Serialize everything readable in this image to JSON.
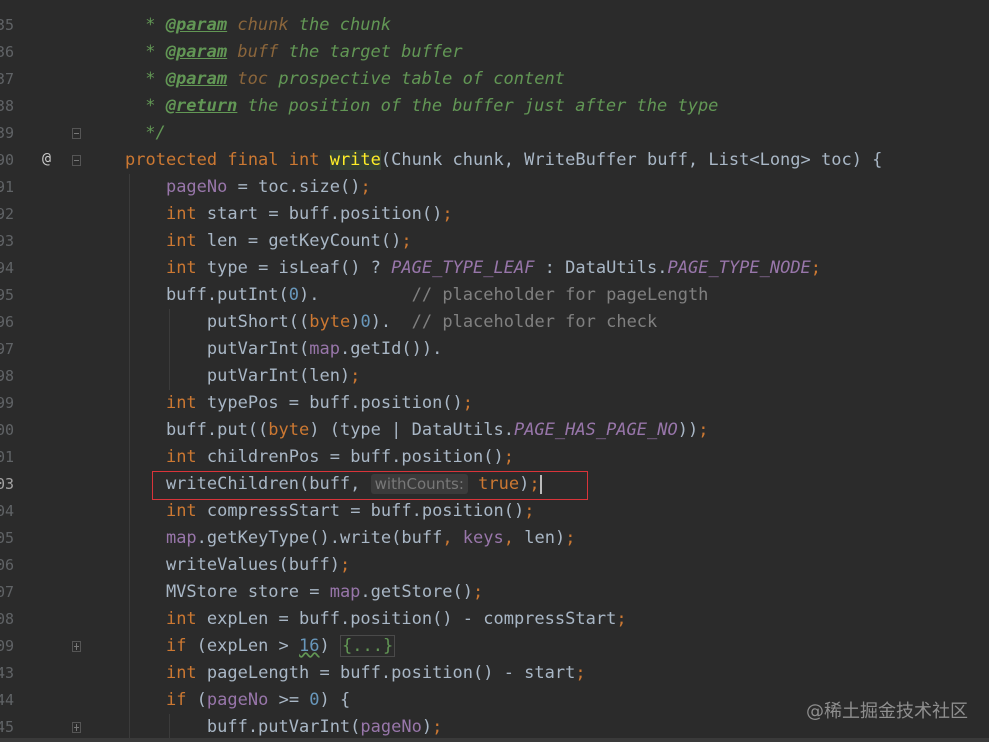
{
  "lines": [
    {
      "num": "35",
      "spans": [
        {
          "t": " * ",
          "c": "doc"
        },
        {
          "t": "@param",
          "c": "tag"
        },
        {
          "t": " ",
          "c": "doc"
        },
        {
          "t": "chunk",
          "c": "param"
        },
        {
          "t": " the chunk",
          "c": "doc"
        }
      ]
    },
    {
      "num": "36",
      "spans": [
        {
          "t": " * ",
          "c": "doc"
        },
        {
          "t": "@param",
          "c": "tag"
        },
        {
          "t": " ",
          "c": "doc"
        },
        {
          "t": "buff",
          "c": "param"
        },
        {
          "t": " the target buffer",
          "c": "doc"
        }
      ]
    },
    {
      "num": "37",
      "spans": [
        {
          "t": " * ",
          "c": "doc"
        },
        {
          "t": "@param",
          "c": "tag"
        },
        {
          "t": " ",
          "c": "doc"
        },
        {
          "t": "toc",
          "c": "param"
        },
        {
          "t": " prospective table of content",
          "c": "doc"
        }
      ]
    },
    {
      "num": "38",
      "spans": [
        {
          "t": " * ",
          "c": "doc"
        },
        {
          "t": "@return",
          "c": "tag"
        },
        {
          "t": " the position of the buffer just after the type",
          "c": "doc"
        }
      ]
    },
    {
      "num": "39",
      "spans": [
        {
          "t": " */",
          "c": "doc"
        }
      ]
    },
    {
      "num": "90",
      "spans": [
        {
          "t": "protected final int ",
          "c": "kw"
        },
        {
          "t": "write",
          "c": "hl"
        },
        {
          "t": "(Chunk chunk, WriteBuffer buff, List<Long> toc) {",
          "c": ""
        }
      ]
    },
    {
      "num": "91",
      "spans": [
        {
          "t": "    ",
          "c": ""
        },
        {
          "t": "pageNo",
          "c": "field"
        },
        {
          "t": " = toc.size()",
          "c": ""
        },
        {
          "t": ";",
          "c": "kw"
        }
      ]
    },
    {
      "num": "92",
      "spans": [
        {
          "t": "    ",
          "c": ""
        },
        {
          "t": "int ",
          "c": "kw"
        },
        {
          "t": "start = buff.position()",
          "c": ""
        },
        {
          "t": ";",
          "c": "kw"
        }
      ]
    },
    {
      "num": "93",
      "spans": [
        {
          "t": "    ",
          "c": ""
        },
        {
          "t": "int ",
          "c": "kw"
        },
        {
          "t": "len = getKeyCount()",
          "c": ""
        },
        {
          "t": ";",
          "c": "kw"
        }
      ]
    },
    {
      "num": "94",
      "spans": [
        {
          "t": "    ",
          "c": ""
        },
        {
          "t": "int ",
          "c": "kw"
        },
        {
          "t": "type = isLeaf() ? ",
          "c": ""
        },
        {
          "t": "PAGE_TYPE_LEAF",
          "c": "const"
        },
        {
          "t": " : DataUtils.",
          "c": ""
        },
        {
          "t": "PAGE_TYPE_NODE",
          "c": "const"
        },
        {
          "t": ";",
          "c": "kw"
        }
      ]
    },
    {
      "num": "95",
      "spans": [
        {
          "t": "    buff.putInt(",
          "c": ""
        },
        {
          "t": "0",
          "c": "num"
        },
        {
          "t": ").         ",
          "c": ""
        },
        {
          "t": "// placeholder for pageLength",
          "c": "cmt"
        }
      ]
    },
    {
      "num": "96",
      "spans": [
        {
          "t": "        putShort((",
          "c": ""
        },
        {
          "t": "byte",
          "c": "kw"
        },
        {
          "t": ")",
          "c": ""
        },
        {
          "t": "0",
          "c": "num"
        },
        {
          "t": ").  ",
          "c": ""
        },
        {
          "t": "// placeholder for check",
          "c": "cmt"
        }
      ]
    },
    {
      "num": "97",
      "spans": [
        {
          "t": "        putVarInt(",
          "c": ""
        },
        {
          "t": "map",
          "c": "field"
        },
        {
          "t": ".getId()).",
          "c": ""
        }
      ]
    },
    {
      "num": "98",
      "spans": [
        {
          "t": "        putVarInt(len)",
          "c": ""
        },
        {
          "t": ";",
          "c": "kw"
        }
      ]
    },
    {
      "num": "99",
      "spans": [
        {
          "t": "    ",
          "c": ""
        },
        {
          "t": "int ",
          "c": "kw"
        },
        {
          "t": "typePos = buff.position()",
          "c": ""
        },
        {
          "t": ";",
          "c": "kw"
        }
      ]
    },
    {
      "num": "00",
      "spans": [
        {
          "t": "    buff.put((",
          "c": ""
        },
        {
          "t": "byte",
          "c": "kw"
        },
        {
          "t": ") (type | DataUtils.",
          "c": ""
        },
        {
          "t": "PAGE_HAS_PAGE_NO",
          "c": "const"
        },
        {
          "t": "))",
          "c": ""
        },
        {
          "t": ";",
          "c": "kw"
        }
      ]
    },
    {
      "num": "01",
      "spans": [
        {
          "t": "    ",
          "c": ""
        },
        {
          "t": "int ",
          "c": "kw"
        },
        {
          "t": "childrenPos = buff.position()",
          "c": ""
        },
        {
          "t": ";",
          "c": "kw"
        }
      ]
    },
    {
      "num": "03",
      "spans": [
        {
          "t": "    writeChildren(buff, ",
          "c": ""
        },
        {
          "t": "withCounts:",
          "c": "hint"
        },
        {
          "t": " ",
          "c": ""
        },
        {
          "t": "true",
          "c": "kw"
        },
        {
          "t": ")",
          "c": ""
        },
        {
          "t": ";",
          "c": "kw"
        },
        {
          "t": "",
          "c": "caret"
        }
      ]
    },
    {
      "num": "04",
      "spans": [
        {
          "t": "    ",
          "c": ""
        },
        {
          "t": "int ",
          "c": "kw"
        },
        {
          "t": "compressStart = buff.position()",
          "c": ""
        },
        {
          "t": ";",
          "c": "kw"
        }
      ]
    },
    {
      "num": "05",
      "spans": [
        {
          "t": "    ",
          "c": ""
        },
        {
          "t": "map",
          "c": "field"
        },
        {
          "t": ".getKeyType().write(buff",
          "c": ""
        },
        {
          "t": ", ",
          "c": "kw"
        },
        {
          "t": "keys",
          "c": "field"
        },
        {
          "t": ", ",
          "c": "kw"
        },
        {
          "t": "len)",
          "c": ""
        },
        {
          "t": ";",
          "c": "kw"
        }
      ]
    },
    {
      "num": "06",
      "spans": [
        {
          "t": "    writeValues(buff)",
          "c": ""
        },
        {
          "t": ";",
          "c": "kw"
        }
      ]
    },
    {
      "num": "07",
      "spans": [
        {
          "t": "    MVStore store = ",
          "c": ""
        },
        {
          "t": "map",
          "c": "field"
        },
        {
          "t": ".getStore()",
          "c": ""
        },
        {
          "t": ";",
          "c": "kw"
        }
      ]
    },
    {
      "num": "08",
      "spans": [
        {
          "t": "    ",
          "c": ""
        },
        {
          "t": "int ",
          "c": "kw"
        },
        {
          "t": "expLen = buff.position() - compressStart",
          "c": ""
        },
        {
          "t": ";",
          "c": "kw"
        }
      ]
    },
    {
      "num": "09",
      "spans": [
        {
          "t": "    ",
          "c": ""
        },
        {
          "t": "if ",
          "c": "kw"
        },
        {
          "t": "(expLen > ",
          "c": ""
        },
        {
          "t": "16",
          "c": "num"
        },
        {
          "t": ") ",
          "c": ""
        },
        {
          "t": "{...}",
          "c": "fold-text"
        }
      ]
    },
    {
      "num": "43",
      "spans": [
        {
          "t": "    ",
          "c": ""
        },
        {
          "t": "int ",
          "c": "kw"
        },
        {
          "t": "pageLength = buff.position() - start",
          "c": ""
        },
        {
          "t": ";",
          "c": "kw"
        }
      ]
    },
    {
      "num": "44",
      "spans": [
        {
          "t": "    ",
          "c": ""
        },
        {
          "t": "if ",
          "c": "kw"
        },
        {
          "t": "(",
          "c": ""
        },
        {
          "t": "pageNo",
          "c": "field"
        },
        {
          "t": " >= ",
          "c": ""
        },
        {
          "t": "0",
          "c": "num"
        },
        {
          "t": ") {",
          "c": ""
        }
      ]
    },
    {
      "num": "45",
      "spans": [
        {
          "t": "        buff.putVarInt(",
          "c": ""
        },
        {
          "t": "pageNo",
          "c": "field"
        },
        {
          "t": ")",
          "c": ""
        },
        {
          "t": ";",
          "c": "kw"
        }
      ]
    }
  ],
  "gutter": {
    "override_marker": "@"
  },
  "watermark": "@稀土掘金技术社区"
}
